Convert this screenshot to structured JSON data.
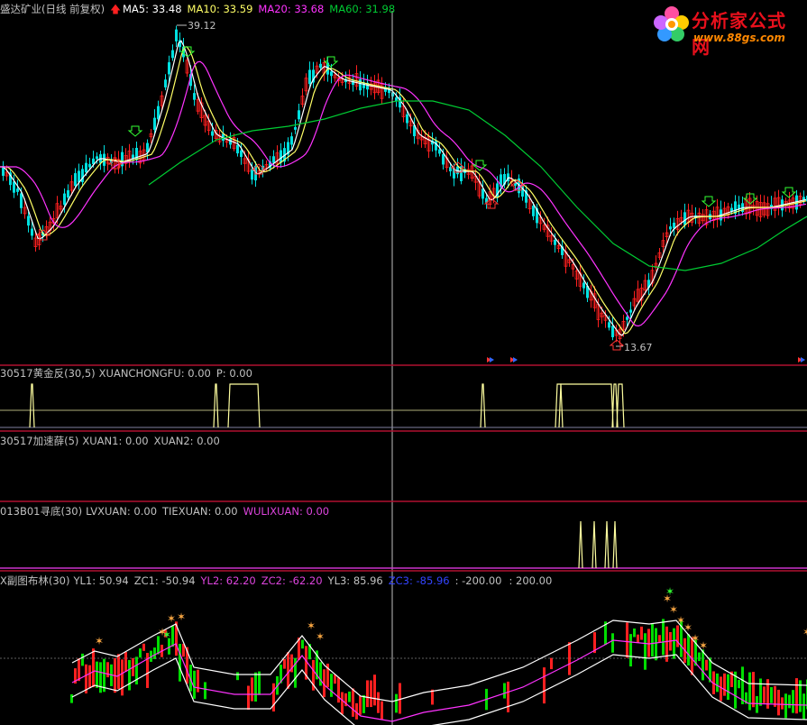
{
  "colors": {
    "background": "#000000",
    "separator": "#b01030",
    "ma5": "#ffffff",
    "ma10": "#ffff66",
    "ma20": "#ff33ff",
    "ma60": "#00cc33",
    "up": "#ff2020",
    "down": "#00e0e0",
    "indicator_line": "#ffffa0",
    "purple": "#cc33cc",
    "green_bar": "#00dd00",
    "red_bar": "#ff2020",
    "gold": "#ffaa44"
  },
  "main": {
    "up_arrow_icon": "red-up-arrow",
    "stock_name": "盛达矿业(日线 前复权)",
    "ma5_label": "MA5: 33.48",
    "ma10_label": "MA10: 33.59",
    "ma20_label": "MA20: 33.68",
    "ma60_label": "MA60: 31.98",
    "high_price": "39.12",
    "low_price": "13.67"
  },
  "panel1": {
    "name": "30517黄金反(30,5)",
    "v1": "XUANCHONGFU: 0.00",
    "v2": "P: 0.00"
  },
  "panel2": {
    "name": "30517加速薛(5)",
    "v1": "XUAN1: 0.00",
    "v2": "XUAN2: 0.00"
  },
  "panel3": {
    "name": "013B01寻底(30)",
    "v1": "LVXUAN: 0.00",
    "v2": "TIEXUAN: 0.00",
    "v3": "WULIXUAN: 0.00"
  },
  "panel4": {
    "name": "X副图布林(30)",
    "v1": "YL1: 50.94",
    "v2": "ZC1: -50.94",
    "v3": "YL2: 62.20",
    "v4": "ZC2: -62.20",
    "v5": "YL3: 85.96",
    "v6": "ZC3: -85.96",
    "v7": ": -200.00",
    "v8": ": 200.00"
  },
  "logo": {
    "title": "分析家公式网",
    "url": "www.88gs.com"
  }
}
